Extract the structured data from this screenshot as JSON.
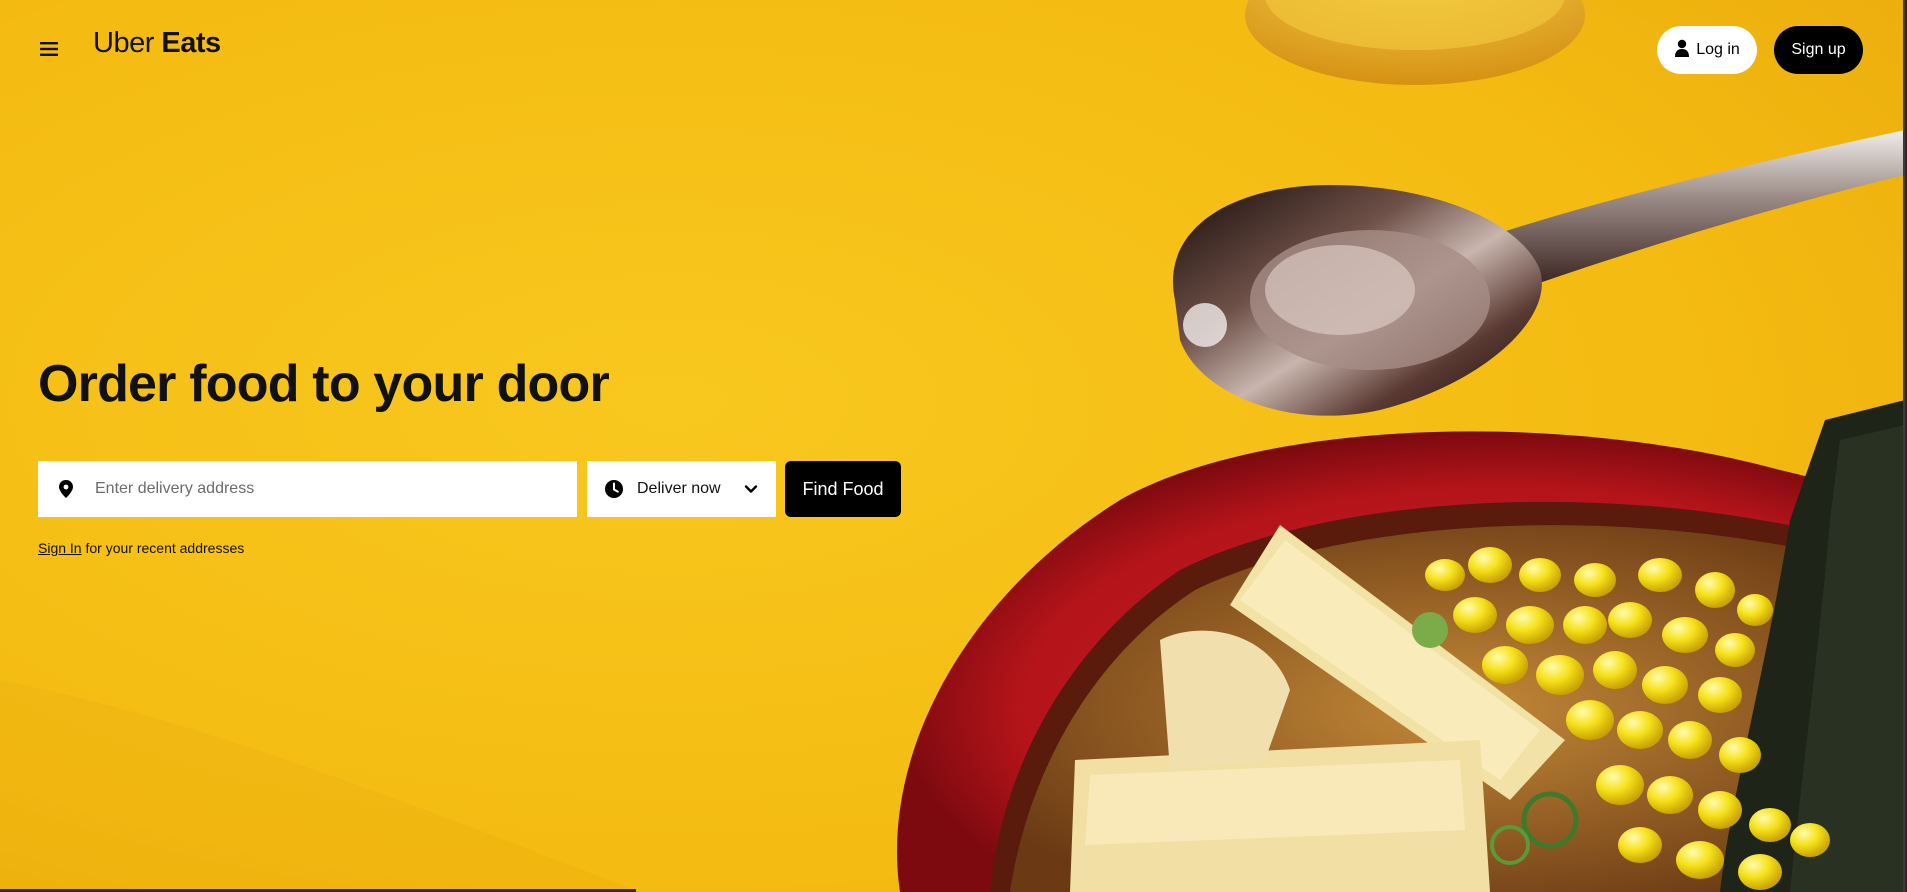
{
  "header": {
    "menu_icon": "hamburger-menu-icon",
    "logo_part1": "Uber",
    "logo_part2": "Eats",
    "login_label": "Log in",
    "login_icon": "user-icon",
    "signup_label": "Sign up"
  },
  "hero": {
    "headline": "Order food to your door",
    "address_placeholder": "Enter delivery address",
    "address_value": "",
    "address_icon": "location-pin-icon",
    "deliver_label": "Deliver now",
    "deliver_icon": "clock-icon",
    "deliver_chevron": "chevron-down-icon",
    "find_label": "Find Food",
    "signin_link": "Sign In",
    "signin_rest": " for your recent addresses"
  },
  "colors": {
    "background": "#f6bf16",
    "primary": "#000000",
    "surface": "#ffffff"
  }
}
